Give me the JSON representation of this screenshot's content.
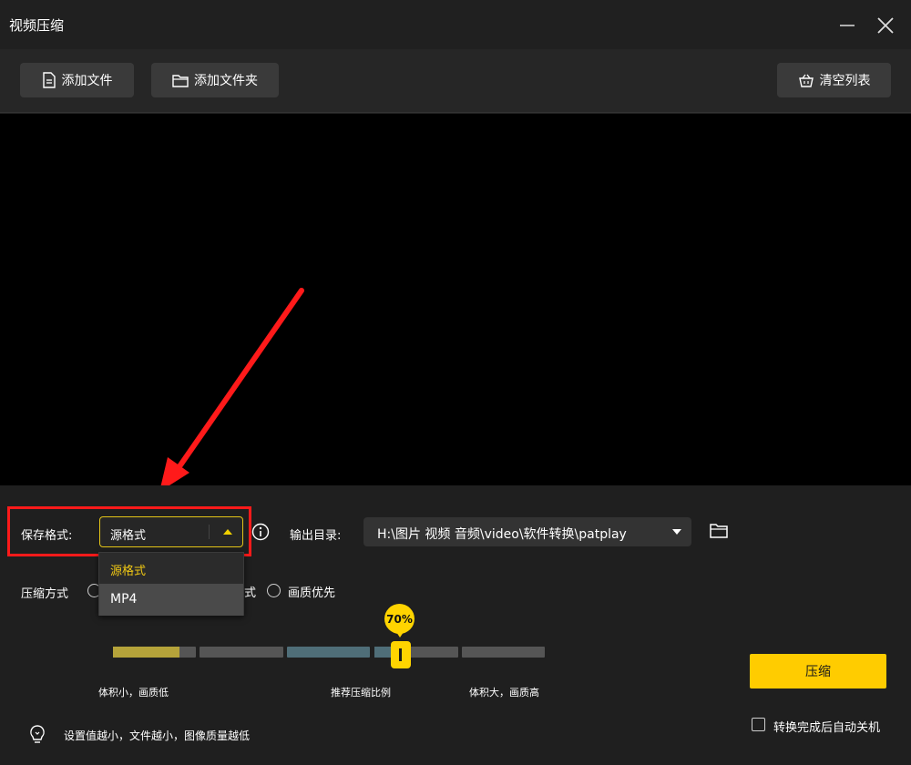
{
  "window": {
    "title": "视频压缩"
  },
  "toolbar": {
    "add_file_label": "添加文件",
    "add_folder_label": "添加文件夹",
    "clear_list_label": "清空列表"
  },
  "settings": {
    "format_label": "保存格式:",
    "format_value": "源格式",
    "format_options": [
      "源格式",
      "MP4"
    ],
    "output_label": "输出目录:",
    "output_path": "H:\\图片 视频 音频\\video\\软件转换\\patplay",
    "mode_label": "压缩方式",
    "mode_partial_label": "式",
    "mode_quality_label": "画质优先"
  },
  "slider": {
    "value_label": "70%",
    "value": 70,
    "caption_low": "体积小，画质低",
    "caption_mid": "推荐压缩比例",
    "caption_high": "体积大，画质高"
  },
  "hint": {
    "text": "设置值越小，文件越小，图像质量越低"
  },
  "actions": {
    "compress_label": "压缩",
    "auto_shutdown_label": "转换完成后自动关机"
  },
  "colors": {
    "accent": "#ffcc00",
    "highlight": "#ff1a1a",
    "background": "#1f1f1f"
  }
}
